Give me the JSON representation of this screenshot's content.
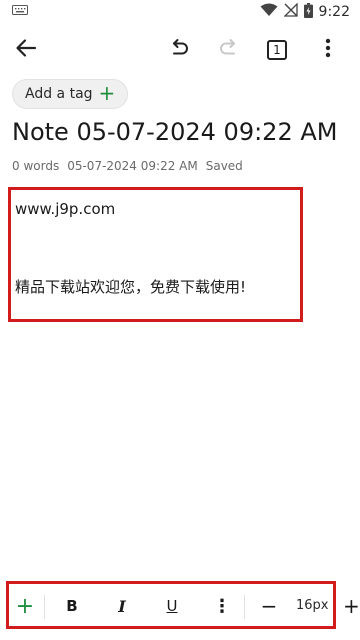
{
  "status_bar": {
    "time": "9:22",
    "icons": [
      "keyboard-icon",
      "wifi-icon",
      "no-signal-icon",
      "battery-icon"
    ]
  },
  "toolbar": {
    "page_count": "1",
    "icons": [
      "back-arrow-icon",
      "undo-icon",
      "redo-icon",
      "pages-icon",
      "more-vert-icon"
    ]
  },
  "tag": {
    "label": "Add a tag",
    "plus": "+"
  },
  "note": {
    "title": "Note 05-07-2024 09:22 AM",
    "meta": {
      "word_count": "0 words",
      "timestamp": "05-07-2024 09:22 AM",
      "status": "Saved"
    },
    "lines": [
      "www.j9p.com",
      "精品下载站欢迎您，免费下载使用!"
    ]
  },
  "format_bar": {
    "add": "+",
    "bold": "B",
    "italic": "I",
    "underline": "U",
    "more": "⋮",
    "decrease": "−",
    "font_size": "16px",
    "increase": "+"
  },
  "colors": {
    "accent_green": "#1e8e3e",
    "highlight_red": "#d21b1b"
  }
}
